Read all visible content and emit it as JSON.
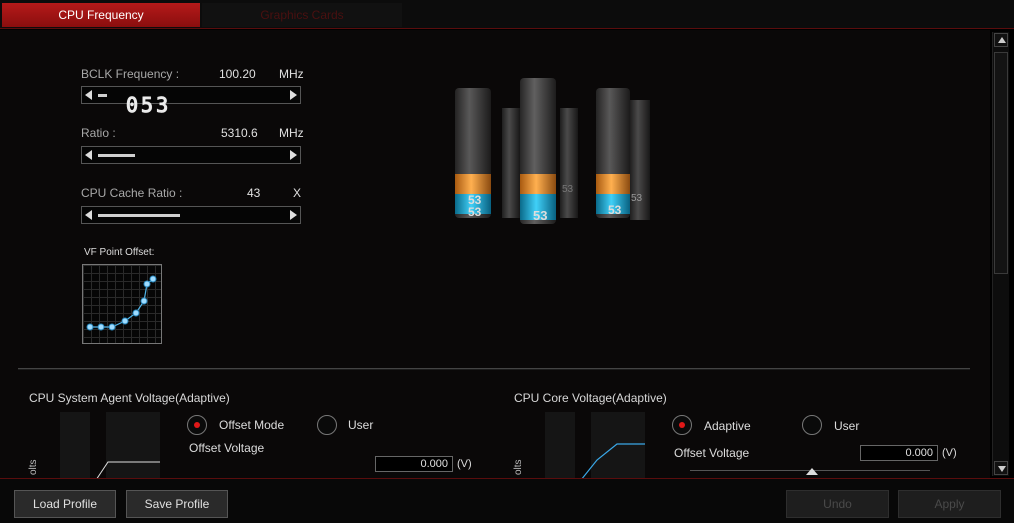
{
  "tabs": {
    "cpu_frequency": "CPU Frequency",
    "graphics_cards": "Graphics Cards"
  },
  "frequency": {
    "bclk_label": "BCLK Frequency :",
    "bclk_value": "100.20",
    "bclk_unit": "MHz",
    "bclk_slider_position": 0.05,
    "ratio_label": "Ratio :",
    "ratio_display": "053",
    "ratio_value": "5310.6",
    "ratio_unit": "MHz",
    "ratio_slider_position": 0.2,
    "cache_label": "CPU Cache Ratio :",
    "cache_value": "43",
    "cache_unit": "X",
    "cache_slider_position": 0.44
  },
  "vf_offset": {
    "title": "VF Point Offset:"
  },
  "cores": {
    "display_labels": [
      "53",
      "53",
      "53",
      "53",
      "53",
      "53"
    ]
  },
  "sa_voltage": {
    "title": "CPU System Agent Voltage(Adaptive)",
    "axis_label": "olts",
    "mode_offset": "Offset Mode",
    "mode_user": "User",
    "offset_label": "Offset Voltage",
    "offset_value": "0.000",
    "offset_unit": "(V)"
  },
  "core_voltage": {
    "title": "CPU Core Voltage(Adaptive)",
    "axis_label": "olts",
    "mode_adaptive": "Adaptive",
    "mode_user": "User",
    "offset_label": "Offset Voltage",
    "offset_value": "0.000",
    "offset_unit": "(V)"
  },
  "buttons": {
    "load_profile": "Load Profile",
    "save_profile": "Save Profile",
    "undo": "Undo",
    "apply": "Apply"
  },
  "colors": {
    "accent_red": "#b51a1a",
    "curve_blue": "#4fb4e8",
    "cylinder_orange": "#f0902a",
    "cylinder_cyan": "#20b4d8"
  }
}
